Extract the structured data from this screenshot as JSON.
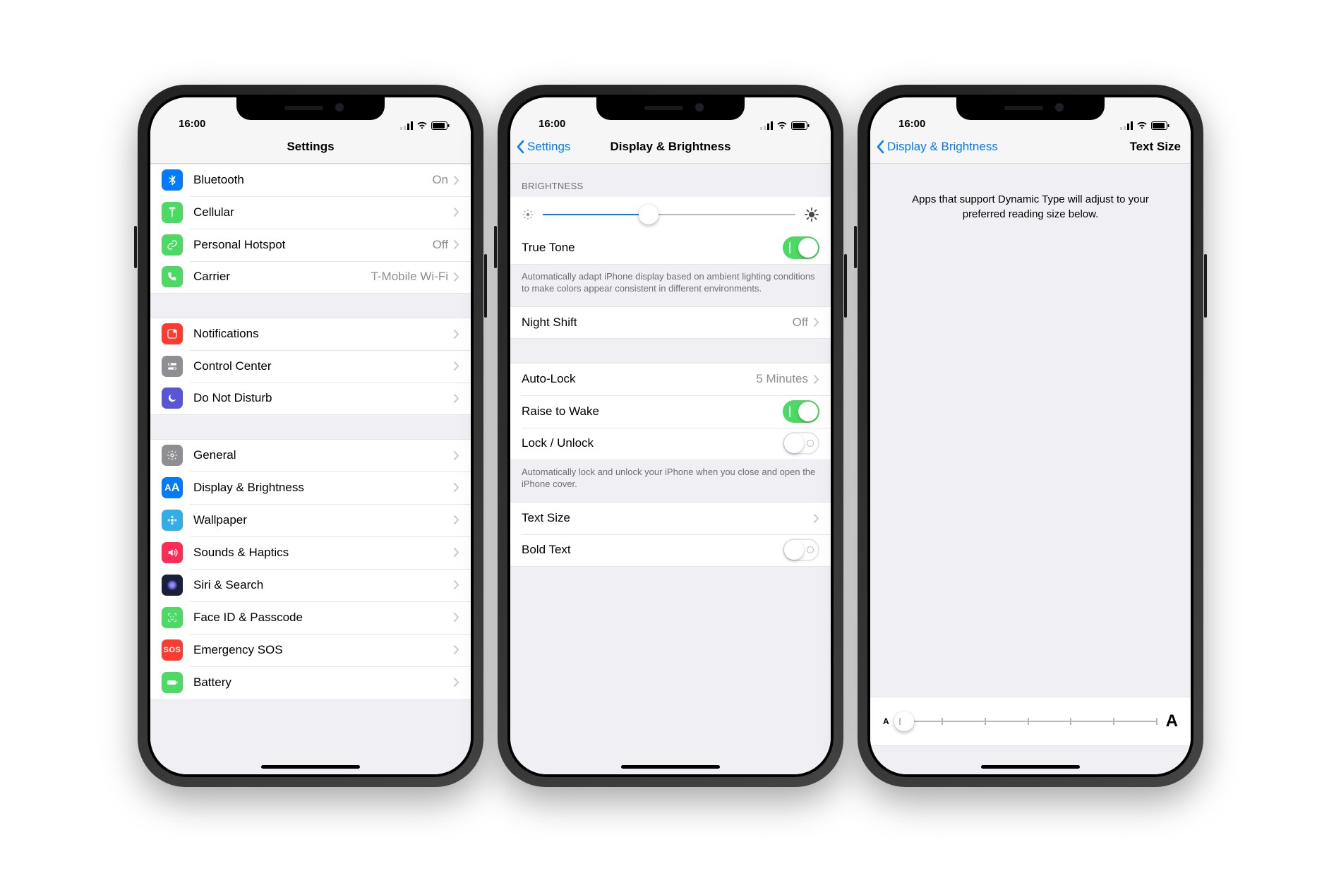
{
  "status": {
    "time": "16:00"
  },
  "phones": [
    {
      "title": "Settings",
      "back": null,
      "groups": [
        [
          {
            "id": "bluetooth",
            "label": "Bluetooth",
            "value": "On",
            "icon": "bluetooth",
            "color": "#007aff"
          },
          {
            "id": "cellular",
            "label": "Cellular",
            "icon": "antenna",
            "color": "#4cd964"
          },
          {
            "id": "personal-hotspot",
            "label": "Personal Hotspot",
            "value": "Off",
            "icon": "link",
            "color": "#4cd964"
          },
          {
            "id": "carrier",
            "label": "Carrier",
            "value": "T-Mobile Wi-Fi",
            "icon": "phone",
            "color": "#4cd964"
          }
        ],
        [
          {
            "id": "notifications",
            "label": "Notifications",
            "icon": "notif",
            "color": "#ff3b30"
          },
          {
            "id": "control-center",
            "label": "Control Center",
            "icon": "toggles",
            "color": "#8e8e93"
          },
          {
            "id": "do-not-disturb",
            "label": "Do Not Disturb",
            "icon": "moon",
            "color": "#5856d6"
          }
        ],
        [
          {
            "id": "general",
            "label": "General",
            "icon": "gear",
            "color": "#8e8e93"
          },
          {
            "id": "display-brightness",
            "label": "Display & Brightness",
            "icon": "aa",
            "color": "#007aff"
          },
          {
            "id": "wallpaper",
            "label": "Wallpaper",
            "icon": "flower",
            "color": "#32ade6"
          },
          {
            "id": "sounds-haptics",
            "label": "Sounds & Haptics",
            "icon": "volume",
            "color": "#ff2d55"
          },
          {
            "id": "siri-search",
            "label": "Siri & Search",
            "icon": "siri",
            "color": "#1b1f3a"
          },
          {
            "id": "face-id-passcode",
            "label": "Face ID & Passcode",
            "icon": "face",
            "color": "#4cd964"
          },
          {
            "id": "emergency-sos",
            "label": "Emergency SOS",
            "icon": "sos",
            "color": "#ff3b30"
          },
          {
            "id": "battery",
            "label": "Battery",
            "icon": "battery",
            "color": "#4cd964",
            "partial": true
          }
        ]
      ]
    },
    {
      "title": "Display & Brightness",
      "back": "Settings",
      "sections": {
        "brightness_header": "BRIGHTNESS",
        "brightness_pct": 42,
        "truetone": {
          "label": "True Tone",
          "on": true
        },
        "truetone_footer": "Automatically adapt iPhone display based on ambient lighting conditions to make colors appear consistent in different environments.",
        "nightshift": {
          "label": "Night Shift",
          "value": "Off"
        },
        "autolock": {
          "label": "Auto-Lock",
          "value": "5 Minutes"
        },
        "raisetowake": {
          "label": "Raise to Wake",
          "on": true
        },
        "lockunlock": {
          "label": "Lock / Unlock",
          "on": false
        },
        "lockunlock_footer": "Automatically lock and unlock your iPhone when you close and open the iPhone cover.",
        "textsize": {
          "label": "Text Size"
        },
        "boldtext": {
          "label": "Bold Text",
          "on": false
        }
      }
    },
    {
      "title": "Text Size",
      "back": "Display & Brightness",
      "description": "Apps that support Dynamic Type will adjust to your preferred reading size below.",
      "slider_small": "A",
      "slider_large": "A",
      "slider_steps": 7,
      "slider_pos": 0
    }
  ]
}
